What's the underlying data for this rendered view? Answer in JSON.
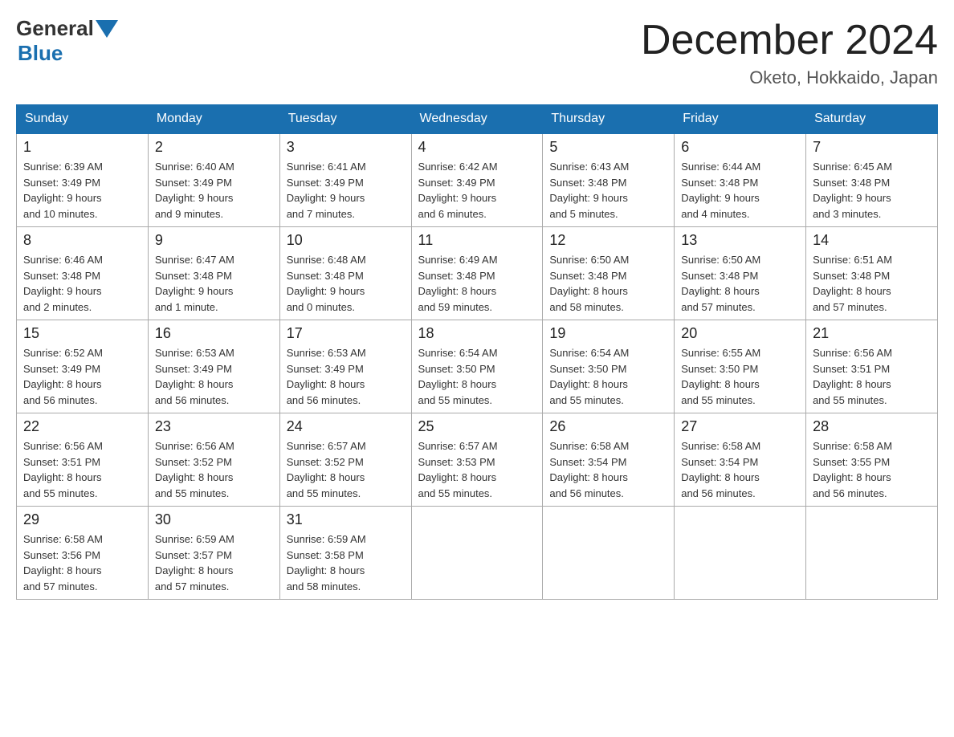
{
  "logo": {
    "general": "General",
    "blue": "Blue"
  },
  "title": "December 2024",
  "location": "Oketo, Hokkaido, Japan",
  "days_of_week": [
    "Sunday",
    "Monday",
    "Tuesday",
    "Wednesday",
    "Thursday",
    "Friday",
    "Saturday"
  ],
  "weeks": [
    [
      {
        "day": "1",
        "sunrise": "6:39 AM",
        "sunset": "3:49 PM",
        "daylight": "9 hours and 10 minutes."
      },
      {
        "day": "2",
        "sunrise": "6:40 AM",
        "sunset": "3:49 PM",
        "daylight": "9 hours and 9 minutes."
      },
      {
        "day": "3",
        "sunrise": "6:41 AM",
        "sunset": "3:49 PM",
        "daylight": "9 hours and 7 minutes."
      },
      {
        "day": "4",
        "sunrise": "6:42 AM",
        "sunset": "3:49 PM",
        "daylight": "9 hours and 6 minutes."
      },
      {
        "day": "5",
        "sunrise": "6:43 AM",
        "sunset": "3:48 PM",
        "daylight": "9 hours and 5 minutes."
      },
      {
        "day": "6",
        "sunrise": "6:44 AM",
        "sunset": "3:48 PM",
        "daylight": "9 hours and 4 minutes."
      },
      {
        "day": "7",
        "sunrise": "6:45 AM",
        "sunset": "3:48 PM",
        "daylight": "9 hours and 3 minutes."
      }
    ],
    [
      {
        "day": "8",
        "sunrise": "6:46 AM",
        "sunset": "3:48 PM",
        "daylight": "9 hours and 2 minutes."
      },
      {
        "day": "9",
        "sunrise": "6:47 AM",
        "sunset": "3:48 PM",
        "daylight": "9 hours and 1 minute."
      },
      {
        "day": "10",
        "sunrise": "6:48 AM",
        "sunset": "3:48 PM",
        "daylight": "9 hours and 0 minutes."
      },
      {
        "day": "11",
        "sunrise": "6:49 AM",
        "sunset": "3:48 PM",
        "daylight": "8 hours and 59 minutes."
      },
      {
        "day": "12",
        "sunrise": "6:50 AM",
        "sunset": "3:48 PM",
        "daylight": "8 hours and 58 minutes."
      },
      {
        "day": "13",
        "sunrise": "6:50 AM",
        "sunset": "3:48 PM",
        "daylight": "8 hours and 57 minutes."
      },
      {
        "day": "14",
        "sunrise": "6:51 AM",
        "sunset": "3:48 PM",
        "daylight": "8 hours and 57 minutes."
      }
    ],
    [
      {
        "day": "15",
        "sunrise": "6:52 AM",
        "sunset": "3:49 PM",
        "daylight": "8 hours and 56 minutes."
      },
      {
        "day": "16",
        "sunrise": "6:53 AM",
        "sunset": "3:49 PM",
        "daylight": "8 hours and 56 minutes."
      },
      {
        "day": "17",
        "sunrise": "6:53 AM",
        "sunset": "3:49 PM",
        "daylight": "8 hours and 56 minutes."
      },
      {
        "day": "18",
        "sunrise": "6:54 AM",
        "sunset": "3:50 PM",
        "daylight": "8 hours and 55 minutes."
      },
      {
        "day": "19",
        "sunrise": "6:54 AM",
        "sunset": "3:50 PM",
        "daylight": "8 hours and 55 minutes."
      },
      {
        "day": "20",
        "sunrise": "6:55 AM",
        "sunset": "3:50 PM",
        "daylight": "8 hours and 55 minutes."
      },
      {
        "day": "21",
        "sunrise": "6:56 AM",
        "sunset": "3:51 PM",
        "daylight": "8 hours and 55 minutes."
      }
    ],
    [
      {
        "day": "22",
        "sunrise": "6:56 AM",
        "sunset": "3:51 PM",
        "daylight": "8 hours and 55 minutes."
      },
      {
        "day": "23",
        "sunrise": "6:56 AM",
        "sunset": "3:52 PM",
        "daylight": "8 hours and 55 minutes."
      },
      {
        "day": "24",
        "sunrise": "6:57 AM",
        "sunset": "3:52 PM",
        "daylight": "8 hours and 55 minutes."
      },
      {
        "day": "25",
        "sunrise": "6:57 AM",
        "sunset": "3:53 PM",
        "daylight": "8 hours and 55 minutes."
      },
      {
        "day": "26",
        "sunrise": "6:58 AM",
        "sunset": "3:54 PM",
        "daylight": "8 hours and 56 minutes."
      },
      {
        "day": "27",
        "sunrise": "6:58 AM",
        "sunset": "3:54 PM",
        "daylight": "8 hours and 56 minutes."
      },
      {
        "day": "28",
        "sunrise": "6:58 AM",
        "sunset": "3:55 PM",
        "daylight": "8 hours and 56 minutes."
      }
    ],
    [
      {
        "day": "29",
        "sunrise": "6:58 AM",
        "sunset": "3:56 PM",
        "daylight": "8 hours and 57 minutes."
      },
      {
        "day": "30",
        "sunrise": "6:59 AM",
        "sunset": "3:57 PM",
        "daylight": "8 hours and 57 minutes."
      },
      {
        "day": "31",
        "sunrise": "6:59 AM",
        "sunset": "3:58 PM",
        "daylight": "8 hours and 58 minutes."
      },
      null,
      null,
      null,
      null
    ]
  ],
  "labels": {
    "sunrise": "Sunrise:",
    "sunset": "Sunset:",
    "daylight": "Daylight:"
  }
}
